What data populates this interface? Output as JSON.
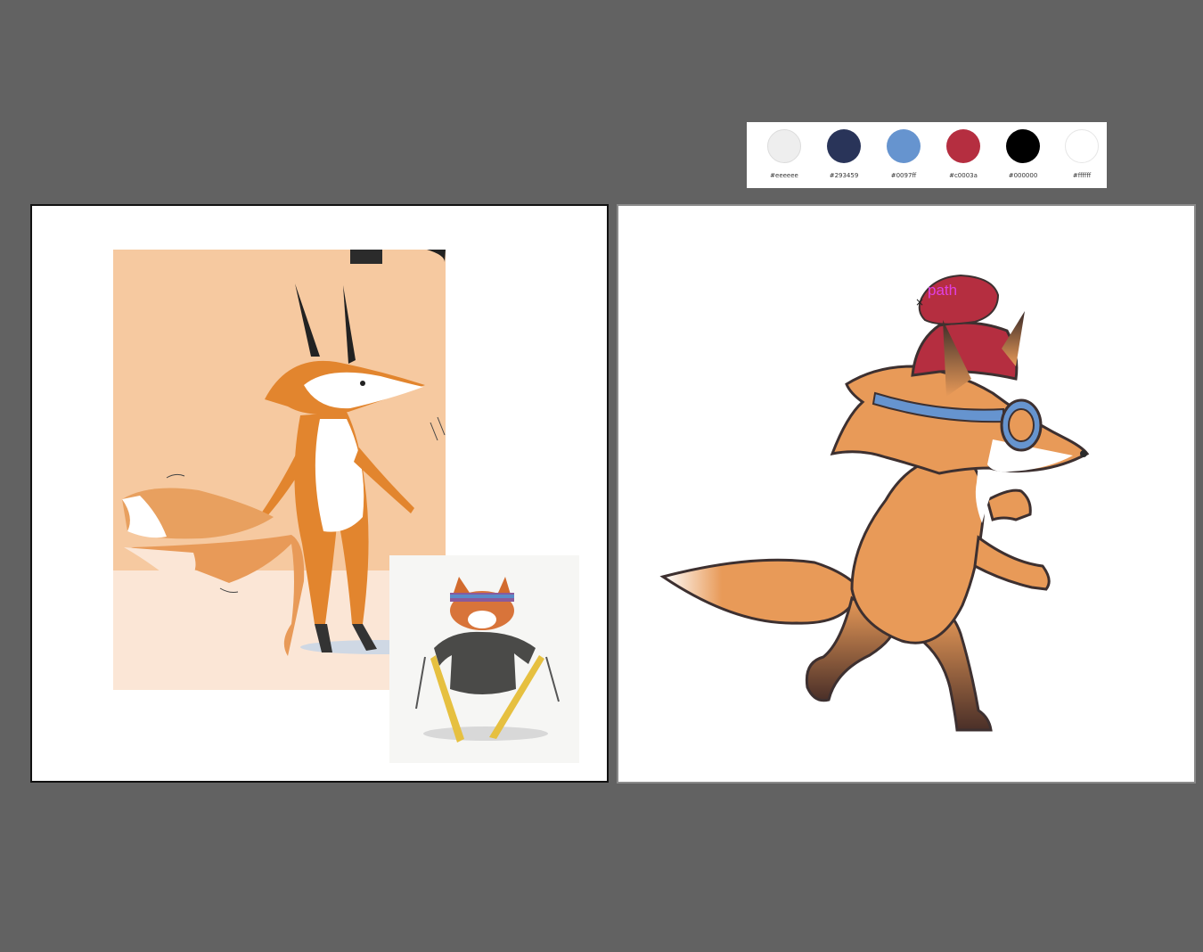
{
  "palette": {
    "swatches": [
      {
        "hex": "#eeeeee",
        "label": "#eeeeee"
      },
      {
        "hex": "#293459",
        "label": "#293459"
      },
      {
        "hex": "#6694cf",
        "label": "#0097ff"
      },
      {
        "hex": "#b52e40",
        "label": "#c0003a"
      },
      {
        "hex": "#000000",
        "label": "#000000"
      },
      {
        "hex": "#ffffff",
        "label": "#ffffff"
      }
    ]
  },
  "canvas": {
    "selection_label": "path",
    "cursor_glyph": "×"
  },
  "colors": {
    "workspace": "#626262",
    "fox_orange": "#e89a58",
    "fox_dark": "#4a2f28",
    "outline": "#3d3030",
    "hat_red": "#b52e40",
    "goggle_blue": "#6694cf",
    "reference_bg": "#f6c9a0"
  },
  "icons": {
    "cursor": "crosshair-cursor-icon"
  }
}
